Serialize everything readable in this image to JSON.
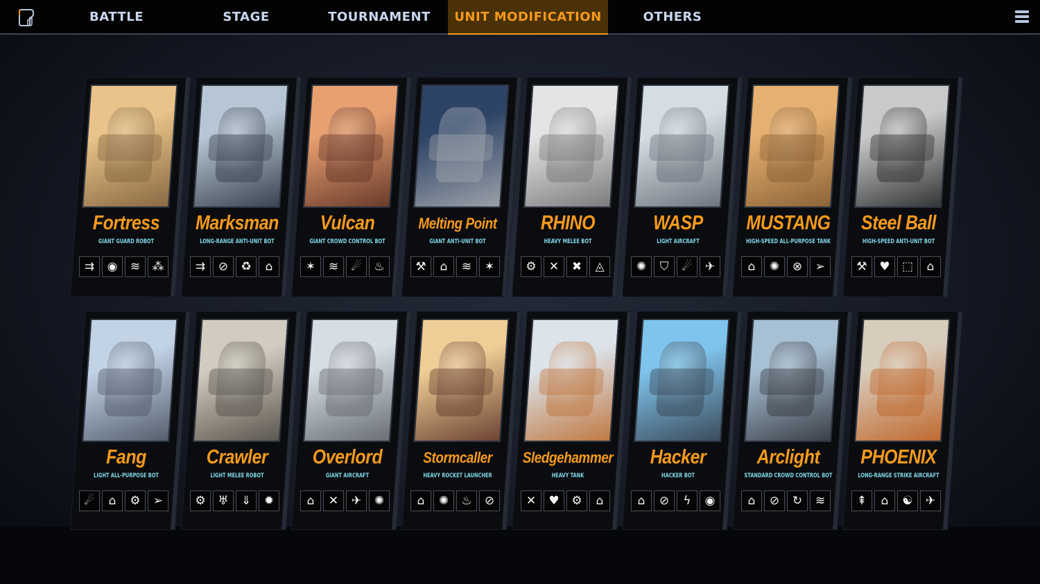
{
  "nav": {
    "tabs": [
      {
        "label": "BATTLE",
        "active": false
      },
      {
        "label": "STAGE",
        "active": false
      },
      {
        "label": "TOURNAMENT",
        "active": false
      },
      {
        "label": "UNIT MODIFICATION",
        "active": true
      },
      {
        "label": "OTHERS",
        "active": false
      }
    ],
    "logo_icon": "game-logo-icon",
    "menu_icon": "hamburger-menu-icon"
  },
  "colors": {
    "accent": "#f59a1c",
    "active_tab_bg": "#4a3106",
    "nav_text": "#c9d6ee",
    "unit_type_text": "#7fd6e6"
  },
  "units": [
    {
      "name": "Fortress",
      "type": "GIANT GUARD ROBOT",
      "art": [
        "#e9c389",
        "#8a6a44"
      ],
      "skills": [
        {
          "icon": "dual-arrow-icon",
          "glyph": "⇉"
        },
        {
          "icon": "orb-cluster-icon",
          "glyph": "◉"
        },
        {
          "icon": "armor-plating-icon",
          "glyph": "≋"
        },
        {
          "icon": "burst-shot-icon",
          "glyph": "⁂"
        }
      ]
    },
    {
      "name": "Marksman",
      "type": "LONG-RANGE ANTI-UNIT BOT",
      "art": [
        "#b7c6d4",
        "#3b4552"
      ],
      "skills": [
        {
          "icon": "dual-arrow-icon",
          "glyph": "⇉"
        },
        {
          "icon": "emp-icon",
          "glyph": "⊘"
        },
        {
          "icon": "recycle-icon",
          "glyph": "♻"
        },
        {
          "icon": "dome-shield-icon",
          "glyph": "⌂"
        }
      ]
    },
    {
      "name": "Vulcan",
      "type": "GIANT CROWD CONTROL BOT",
      "art": [
        "#e8a070",
        "#6a3c2c"
      ],
      "skills": [
        {
          "icon": "spark-claw-icon",
          "glyph": "✶"
        },
        {
          "icon": "armor-plating-icon",
          "glyph": "≋"
        },
        {
          "icon": "fire-drop-icon",
          "glyph": "☄"
        },
        {
          "icon": "flame-wave-icon",
          "glyph": "♨"
        }
      ]
    },
    {
      "name": "Melting Point",
      "type": "GIANT ANTI-UNIT BOT",
      "art": [
        "#2e4466",
        "#9aa0a8"
      ],
      "skills": [
        {
          "icon": "hammer-icon",
          "glyph": "⚒"
        },
        {
          "icon": "dome-shield-icon",
          "glyph": "⌂"
        },
        {
          "icon": "armor-plating-icon",
          "glyph": "≋"
        },
        {
          "icon": "spark-claw-icon",
          "glyph": "✶"
        }
      ]
    },
    {
      "name": "RHINO",
      "type": "HEAVY MELEE BOT",
      "art": [
        "#e4e4e4",
        "#7d7d7d"
      ],
      "skills": [
        {
          "icon": "gear-saw-icon",
          "glyph": "⚙"
        },
        {
          "icon": "crossed-tools-icon",
          "glyph": "✕"
        },
        {
          "icon": "wrench-repair-icon",
          "glyph": "✖"
        },
        {
          "icon": "triangle-emblem-icon",
          "glyph": "◬"
        }
      ]
    },
    {
      "name": "WASP",
      "type": "LIGHT AIRCRAFT",
      "art": [
        "#d5dde4",
        "#6f7780"
      ],
      "skills": [
        {
          "icon": "implode-icon",
          "glyph": "✺"
        },
        {
          "icon": "shield-icon",
          "glyph": "⛉"
        },
        {
          "icon": "fire-drop-icon",
          "glyph": "☄"
        },
        {
          "icon": "jet-icon",
          "glyph": "✈"
        }
      ]
    },
    {
      "name": "MUSTANG",
      "type": "HIGH-SPEED ALL-PURPOSE TANK",
      "art": [
        "#e6b070",
        "#8c6438"
      ],
      "skills": [
        {
          "icon": "dome-shield-icon",
          "glyph": "⌂"
        },
        {
          "icon": "implode-icon",
          "glyph": "✺"
        },
        {
          "icon": "anti-air-icon",
          "glyph": "⊗"
        },
        {
          "icon": "rocket-icon",
          "glyph": "➢"
        }
      ]
    },
    {
      "name": "Steel Ball",
      "type": "HIGH-SPEED ANTI-UNIT BOT",
      "art": [
        "#c9c9c9",
        "#343638"
      ],
      "skills": [
        {
          "icon": "hammer-icon",
          "glyph": "⚒"
        },
        {
          "icon": "heart-armor-icon",
          "glyph": "♥"
        },
        {
          "icon": "blocks-icon",
          "glyph": "⬚"
        },
        {
          "icon": "dome-shield-icon",
          "glyph": "⌂"
        }
      ]
    },
    {
      "name": "Fang",
      "type": "LIGHT ALL-PURPOSE BOT",
      "art": [
        "#c3d3e6",
        "#55606e"
      ],
      "skills": [
        {
          "icon": "fire-drop-icon",
          "glyph": "☄"
        },
        {
          "icon": "dome-shield-icon",
          "glyph": "⌂"
        },
        {
          "icon": "gear-saw-icon",
          "glyph": "⚙"
        },
        {
          "icon": "rocket-icon",
          "glyph": "➢"
        }
      ]
    },
    {
      "name": "Crawler",
      "type": "LIGHT MELEE ROBOT",
      "art": [
        "#d2ccc0",
        "#5c574f"
      ],
      "skills": [
        {
          "icon": "gear-saw-icon",
          "glyph": "⚙"
        },
        {
          "icon": "jellyfish-icon",
          "glyph": "♅"
        },
        {
          "icon": "drop-down-icon",
          "glyph": "⇓"
        },
        {
          "icon": "explosion-icon",
          "glyph": "✹"
        }
      ]
    },
    {
      "name": "Overlord",
      "type": "GIANT AIRCRAFT",
      "art": [
        "#d7dde4",
        "#6a6f76"
      ],
      "skills": [
        {
          "icon": "dome-shield-icon",
          "glyph": "⌂"
        },
        {
          "icon": "crossed-tools-icon",
          "glyph": "✕"
        },
        {
          "icon": "jet-icon",
          "glyph": "✈"
        },
        {
          "icon": "implode-icon",
          "glyph": "✺"
        }
      ]
    },
    {
      "name": "Stormcaller",
      "type": "HEAVY ROCKET LAUNCHER",
      "art": [
        "#f0cd96",
        "#6e4434"
      ],
      "skills": [
        {
          "icon": "dome-shield-icon",
          "glyph": "⌂"
        },
        {
          "icon": "implode-icon",
          "glyph": "✺"
        },
        {
          "icon": "fire-icon",
          "glyph": "♨"
        },
        {
          "icon": "emp-icon",
          "glyph": "⊘"
        }
      ]
    },
    {
      "name": "Sledgehammer",
      "type": "HEAVY TANK",
      "art": [
        "#dce3ea",
        "#c07a44"
      ],
      "skills": [
        {
          "icon": "crossed-tools-icon",
          "glyph": "✕"
        },
        {
          "icon": "heart-armor-icon",
          "glyph": "♥"
        },
        {
          "icon": "gear-saw-icon",
          "glyph": "⚙"
        },
        {
          "icon": "dome-shield-icon",
          "glyph": "⌂"
        }
      ]
    },
    {
      "name": "Hacker",
      "type": "HACKER BOT",
      "art": [
        "#7fc4ec",
        "#3c4c5c"
      ],
      "skills": [
        {
          "icon": "dome-shield-icon",
          "glyph": "⌂"
        },
        {
          "icon": "emp-icon",
          "glyph": "⊘"
        },
        {
          "icon": "lightning-burst-icon",
          "glyph": "ϟ"
        },
        {
          "icon": "orb-cluster-icon",
          "glyph": "◉"
        }
      ]
    },
    {
      "name": "Arclight",
      "type": "STANDARD CROWD CONTROL BOT",
      "art": [
        "#a8c0d4",
        "#3b4048"
      ],
      "skills": [
        {
          "icon": "dome-shield-icon",
          "glyph": "⌂"
        },
        {
          "icon": "emp-icon",
          "glyph": "⊘"
        },
        {
          "icon": "arc-cycle-icon",
          "glyph": "↻"
        },
        {
          "icon": "armor-plating-icon",
          "glyph": "≋"
        }
      ]
    },
    {
      "name": "PHOENIX",
      "type": "LONG-RANGE STRIKE AIRCRAFT",
      "art": [
        "#d8ccbc",
        "#c06a30"
      ],
      "skills": [
        {
          "icon": "split-arrow-icon",
          "glyph": "⇞"
        },
        {
          "icon": "dome-shield-icon",
          "glyph": "⌂"
        },
        {
          "icon": "repair-field-icon",
          "glyph": "☯"
        },
        {
          "icon": "jet-icon",
          "glyph": "✈"
        }
      ]
    }
  ]
}
